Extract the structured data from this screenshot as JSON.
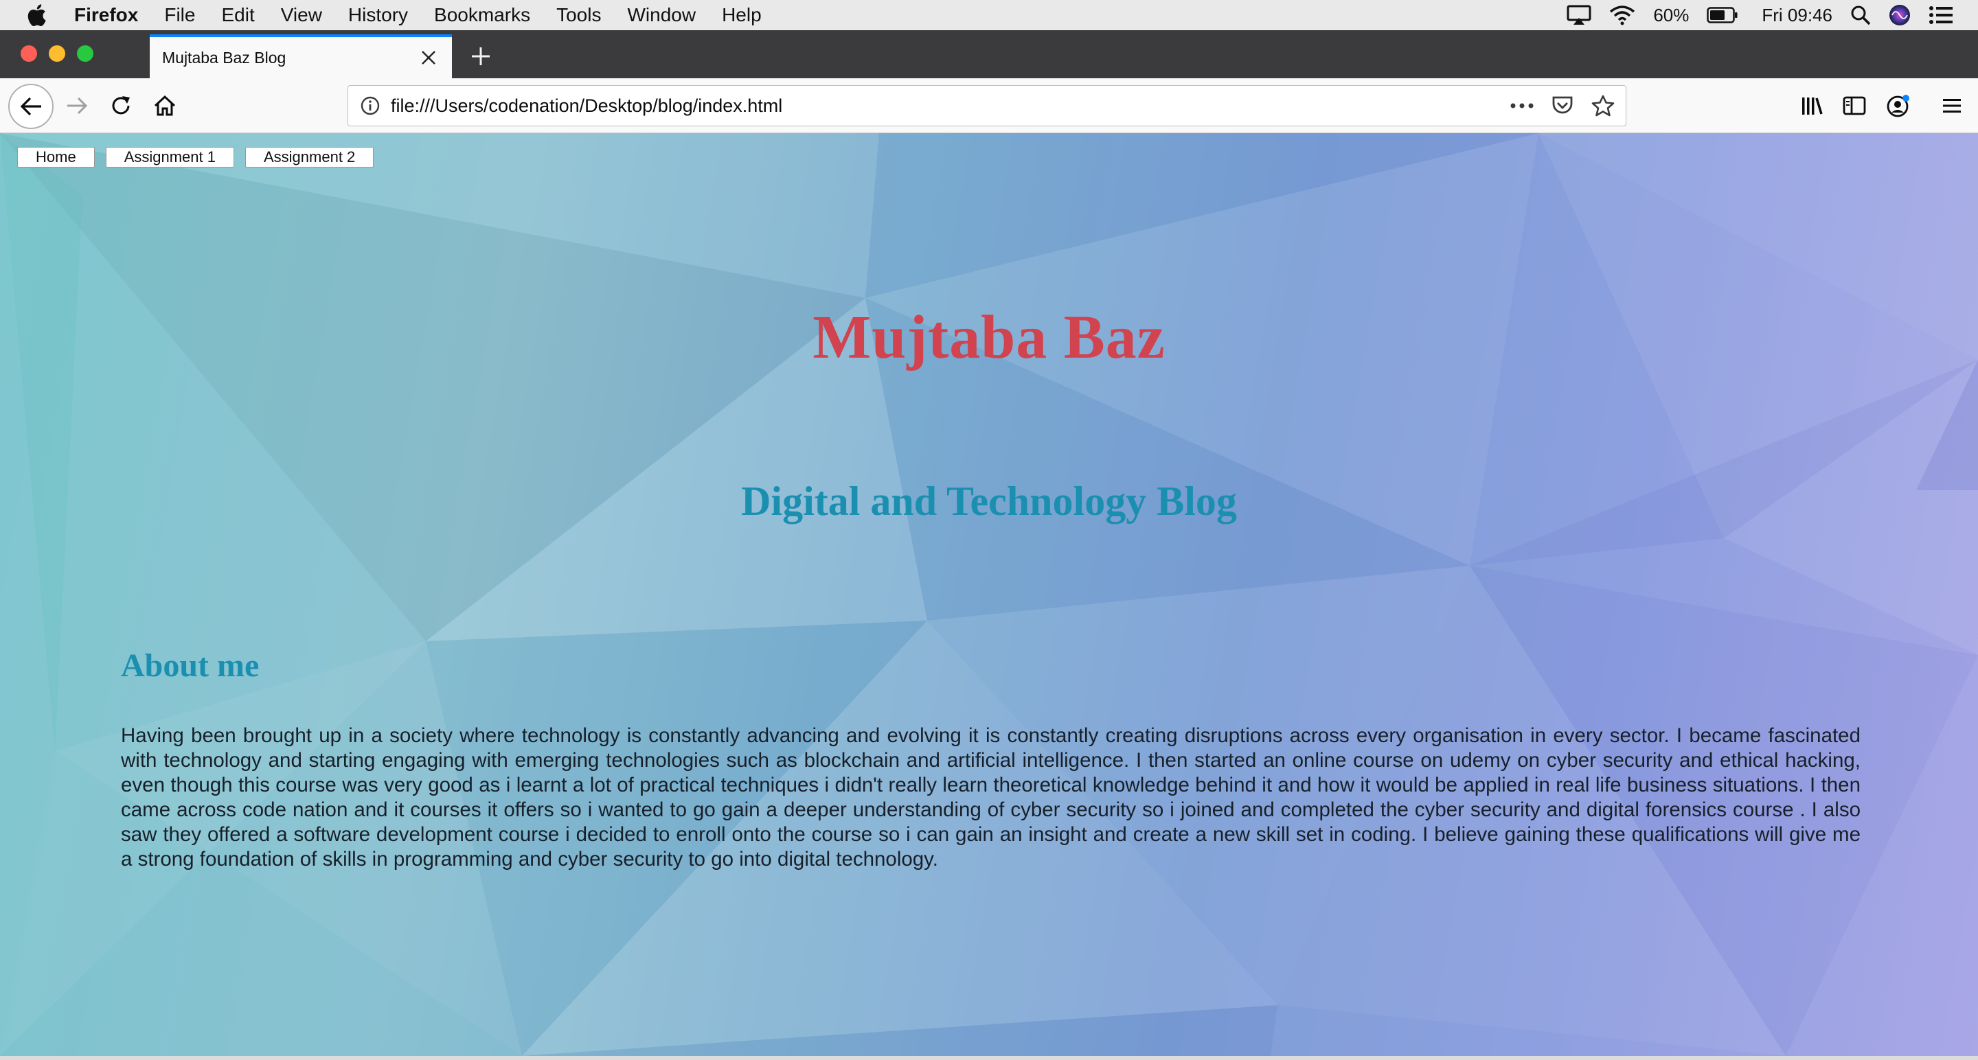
{
  "menubar": {
    "app_name": "Firefox",
    "items": [
      "File",
      "Edit",
      "View",
      "History",
      "Bookmarks",
      "Tools",
      "Window",
      "Help"
    ],
    "battery": "60%",
    "clock": "Fri 09:46",
    "icons": [
      "apple-logo-icon",
      "airplay-icon",
      "wifi-icon",
      "battery-icon",
      "spotlight-search-icon",
      "siri-icon",
      "notification-center-icon"
    ]
  },
  "browser": {
    "tab_title": "Mujtaba Baz Blog",
    "url": "file:///Users/codenation/Desktop/blog/index.html",
    "icons": [
      "back-icon",
      "forward-icon",
      "reload-icon",
      "home-icon",
      "info-icon",
      "page-actions-icon",
      "pocket-icon",
      "bookmark-star-icon",
      "library-icon",
      "sidebar-icon",
      "account-icon",
      "hamburger-menu-icon"
    ]
  },
  "page": {
    "nav": [
      "Home",
      "Assignment 1",
      "Assignment 2"
    ],
    "title": "Mujtaba Baz",
    "subtitle": "Digital and Technology Blog",
    "about_heading": "About me",
    "about_text": "Having been brought up in a society where technology is constantly advancing and evolving it is constantly creating disruptions across every organisation in every sector. I became fascinated with technology and starting engaging with emerging technologies such as blockchain and artificial intelligence. I then started an online course on udemy on cyber security and ethical hacking, even though this course was very good as i learnt a lot of practical techniques i didn't really learn theoretical knowledge behind it and how it would be applied in real life business situations. I then came across code nation and it courses it offers so i wanted to go gain a deeper understanding of cyber security so i joined and completed the cyber security and digital forensics course . I also saw they offered a software development course i decided to enroll onto the course so i can gain an insight and create a new skill set in coding. I believe gaining these qualifications will give me a strong foundation of skills in programming and cyber security to go into digital technology."
  },
  "colors": {
    "title": "#d0434f",
    "subtitle": "#1a8fb0",
    "tab_accent": "#0a84ff",
    "tabstrip": "#3b3b3d"
  }
}
